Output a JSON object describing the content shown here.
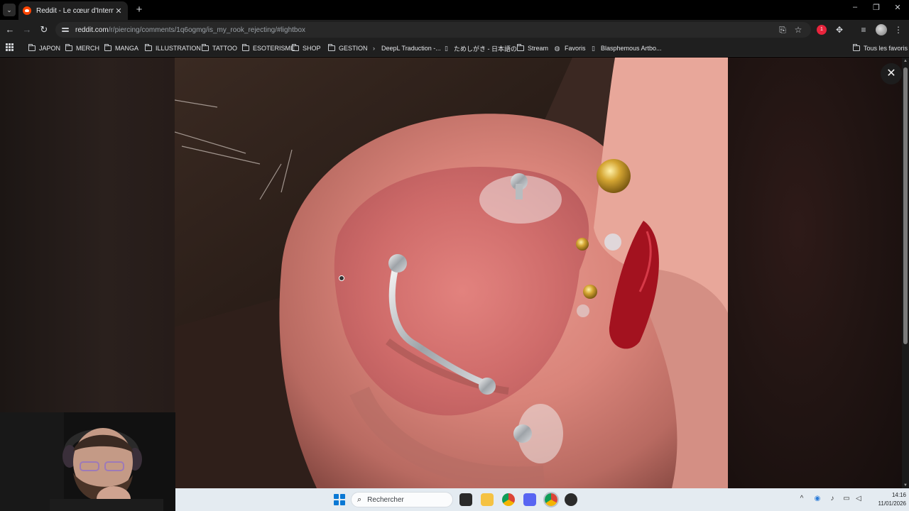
{
  "browser": {
    "tab": {
      "title": "Reddit - Le cœur d'Internet"
    },
    "url": {
      "domain": "reddit.com",
      "path": "/r/piercing/comments/1q6ogmg/is_my_rook_rejecting/#lightbox"
    },
    "extension_badge": "1"
  },
  "bookmarks": [
    {
      "label": "JAPON",
      "icon": "folder-icon"
    },
    {
      "label": "MERCH",
      "icon": "folder-icon"
    },
    {
      "label": "MANGA",
      "icon": "folder-icon"
    },
    {
      "label": "ILLUSTRATION",
      "icon": "folder-icon"
    },
    {
      "label": "TATTOO",
      "icon": "folder-icon"
    },
    {
      "label": "ESOTERISME",
      "icon": "folder-icon"
    },
    {
      "label": "SHOP",
      "icon": "folder-icon"
    },
    {
      "label": "GESTION",
      "icon": "folder-icon"
    },
    {
      "label": "DeepL Traduction -...",
      "icon": "deepl-icon"
    },
    {
      "label": "ためしがき - 日本語の...",
      "icon": "page-icon"
    },
    {
      "label": "Stream",
      "icon": "folder-icon"
    },
    {
      "label": "Favoris",
      "icon": "globe-icon"
    },
    {
      "label": "Blasphemous Artbo...",
      "icon": "page-icon"
    }
  ],
  "all_bookmarks": {
    "label": "Tous les favoris"
  },
  "taskbar": {
    "search_placeholder": "Rechercher",
    "time": "14:16",
    "date": "11/01/2026"
  },
  "colors": {
    "chrome_dark": "#1f1f1f",
    "reddit_orange": "#ff4500",
    "windows_blue": "#0a78d4",
    "taskbar_bg": "#e4ebf1"
  }
}
